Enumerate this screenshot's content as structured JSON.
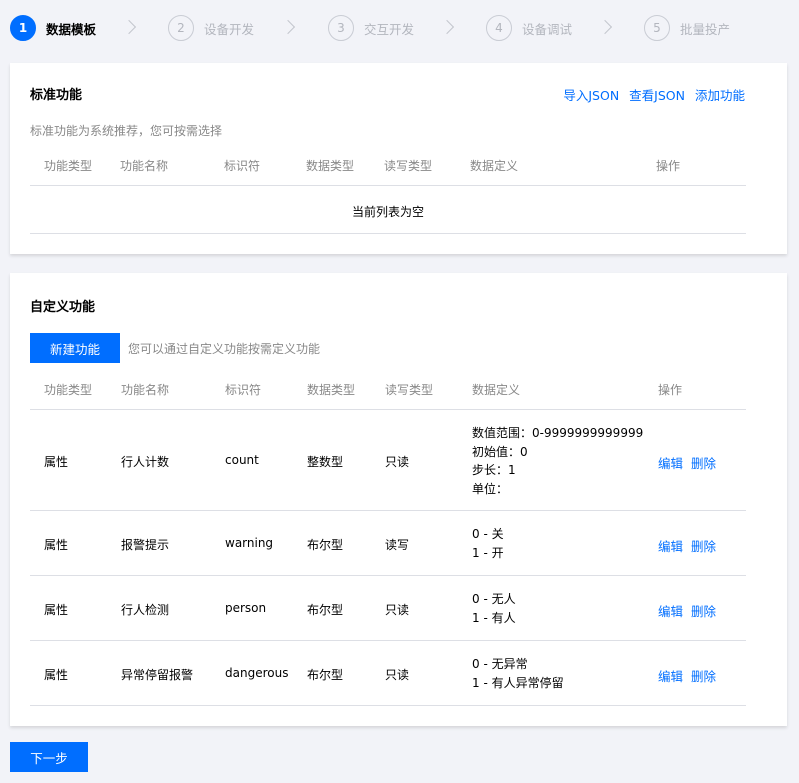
{
  "steps": [
    {
      "num": "1",
      "label": "数据模板"
    },
    {
      "num": "2",
      "label": "设备开发"
    },
    {
      "num": "3",
      "label": "交互开发"
    },
    {
      "num": "4",
      "label": "设备调试"
    },
    {
      "num": "5",
      "label": "批量投产"
    }
  ],
  "standard": {
    "title": "标准功能",
    "import_json": "导入JSON",
    "view_json": "查看JSON",
    "add_function": "添加功能",
    "description": "标准功能为系统推荐，您可按需选择",
    "columns": [
      "功能类型",
      "功能名称",
      "标识符",
      "数据类型",
      "读写类型",
      "数据定义",
      "操作"
    ],
    "empty_text": "当前列表为空"
  },
  "custom": {
    "title": "自定义功能",
    "new_button": "新建功能",
    "hint": "您可以通过自定义功能按需定义功能",
    "columns": [
      "功能类型",
      "功能名称",
      "标识符",
      "数据类型",
      "读写类型",
      "数据定义",
      "操作"
    ],
    "rows": [
      {
        "type": "属性",
        "name": "行人计数",
        "id": "count",
        "data_type": "整数型",
        "rw": "只读",
        "definition": [
          "数值范围：0-9999999999999",
          "初始值：0",
          "步长：1",
          "单位："
        ],
        "edit": "编辑",
        "delete": "删除"
      },
      {
        "type": "属性",
        "name": "报警提示",
        "id": "warning",
        "data_type": "布尔型",
        "rw": "读写",
        "definition": [
          "0 - 关",
          "1 - 开"
        ],
        "edit": "编辑",
        "delete": "删除"
      },
      {
        "type": "属性",
        "name": "行人检测",
        "id": "person",
        "data_type": "布尔型",
        "rw": "只读",
        "definition": [
          "0 - 无人",
          "1 - 有人"
        ],
        "edit": "编辑",
        "delete": "删除"
      },
      {
        "type": "属性",
        "name": "异常停留报警",
        "id": "dangerous",
        "data_type": "布尔型",
        "rw": "只读",
        "definition": [
          "0 - 无异常",
          "1 - 有人异常停留"
        ],
        "edit": "编辑",
        "delete": "删除"
      }
    ]
  },
  "next_button": "下一步",
  "colors": {
    "accent": "#006eff",
    "background": "#f2f3f8",
    "muted": "#888888"
  }
}
